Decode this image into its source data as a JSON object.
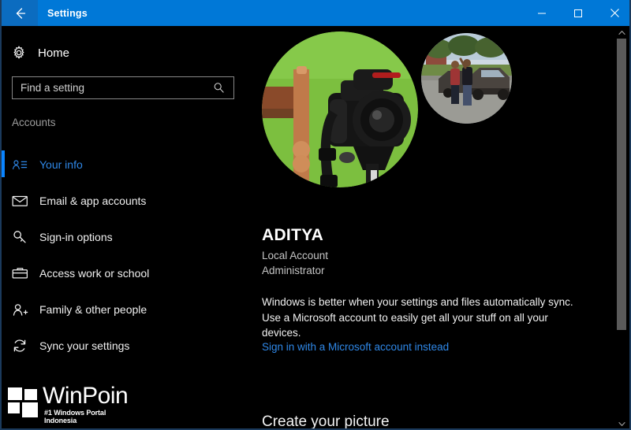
{
  "window": {
    "title": "Settings",
    "back_label": "Back",
    "accent_color": "#0078d7",
    "controls": {
      "minimize": "Minimize",
      "maximize": "Maximize",
      "close": "Close"
    }
  },
  "sidebar": {
    "home_label": "Home",
    "home_icon": "gear-icon",
    "search": {
      "placeholder": "Find a setting",
      "value": "",
      "icon": "search-icon"
    },
    "section_title": "Accounts",
    "items": [
      {
        "label": "Your info",
        "icon": "user-info-icon",
        "selected": true
      },
      {
        "label": "Email & app accounts",
        "icon": "envelope-icon",
        "selected": false
      },
      {
        "label": "Sign-in options",
        "icon": "key-icon",
        "selected": false
      },
      {
        "label": "Access work or school",
        "icon": "briefcase-icon",
        "selected": false
      },
      {
        "label": "Family & other people",
        "icon": "user-plus-icon",
        "selected": false
      },
      {
        "label": "Sync your settings",
        "icon": "sync-icon",
        "selected": false
      }
    ],
    "selected_accent": "#0a84ff"
  },
  "main": {
    "avatar_large": {
      "name": "profile-picture-large",
      "description": "DSLR camera mounted on a tripod in front of a bright green wall with a wooden chair at left"
    },
    "avatar_small": {
      "name": "profile-picture-thumbnail",
      "description": "Two people standing beside a dark car on a sunny street"
    },
    "account_name": "ADITYA",
    "account_type": "Local Account",
    "account_role": "Administrator",
    "sync_description": "Windows is better when your settings and files automatically sync. Use a Microsoft account to easily get all your stuff on all your devices.",
    "sign_in_link": "Sign in with a Microsoft account instead",
    "link_color": "#2f88e8",
    "create_picture_heading": "Create your picture"
  },
  "scrollbar": {
    "up_arrow": "chevron-up-icon",
    "down_arrow": "chevron-down-icon"
  },
  "watermark": {
    "name": "WinPoin",
    "tagline": "#1 Windows Portal Indonesia"
  }
}
